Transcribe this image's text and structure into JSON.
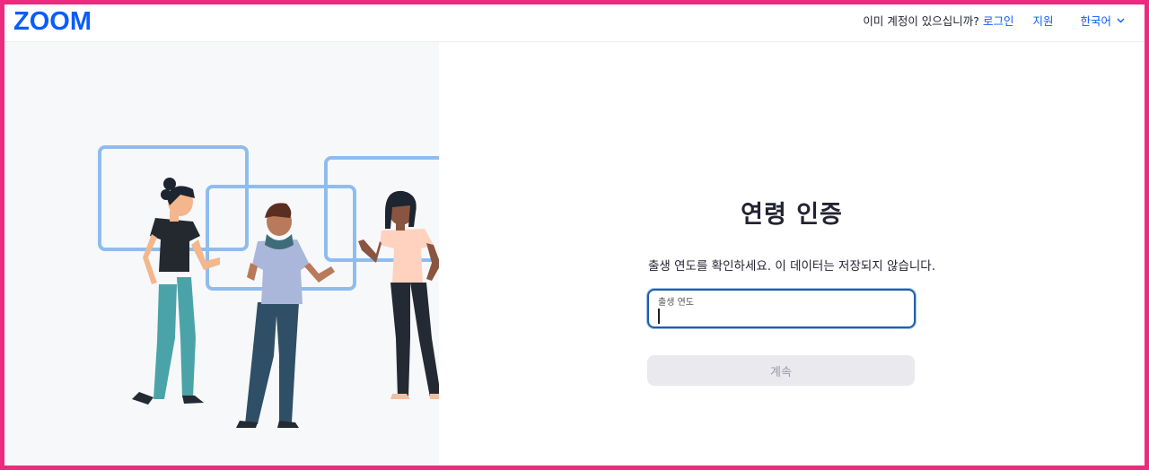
{
  "header": {
    "logo_text": "ZOOM",
    "account_question": "이미 계정이 있으십니까?",
    "login_link": "로그인",
    "support_link": "지원",
    "language": "한국어"
  },
  "main": {
    "title": "연령 인증",
    "description": "출생 연도를 확인하세요. 이 데이터는 저장되지 않습니다.",
    "birth_year_field": {
      "label": "출생 연도",
      "value": ""
    },
    "continue_button": "계속"
  },
  "colors": {
    "border_frame": "#ec2a7e",
    "brand_blue": "#0b5cff",
    "focus_blue": "#1e5fa8",
    "button_disabled_bg": "#e9e9ee",
    "button_disabled_text": "#9a9aa4"
  }
}
